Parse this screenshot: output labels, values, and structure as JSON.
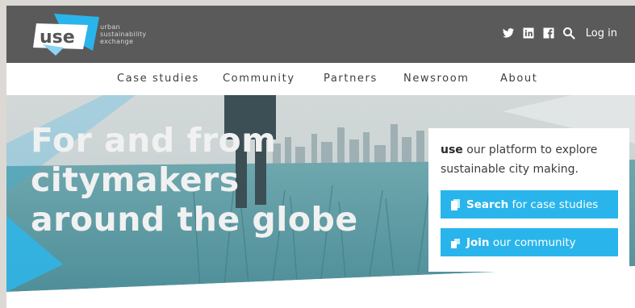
{
  "brand": {
    "logo_text": "use",
    "tagline_lines": [
      "urban",
      "sustainability",
      "exchange"
    ]
  },
  "header": {
    "social_icons": [
      "twitter-icon",
      "linkedin-icon",
      "facebook-icon"
    ],
    "search_icon": "search-icon",
    "login_label": "Log in"
  },
  "nav": {
    "items": [
      {
        "label": "Case studies"
      },
      {
        "label": "Community"
      },
      {
        "label": "Partners"
      },
      {
        "label": "Newsroom"
      },
      {
        "label": "About"
      }
    ]
  },
  "hero": {
    "title_lines": [
      "For and from",
      "citymakers",
      "around the globe"
    ]
  },
  "card": {
    "brand_word": "use",
    "intro_text": " our platform to explore sustainable city making.",
    "search_button": {
      "bold": "Search",
      "rest": " for case studies",
      "icon": "book-icon"
    },
    "join_button": {
      "bold": "Join",
      "rest": " our community",
      "icon": "people-icon"
    }
  },
  "colors": {
    "header_bg": "#5a5a5a",
    "accent": "#29b5eb",
    "hero_teal": "#5a9aa3"
  }
}
